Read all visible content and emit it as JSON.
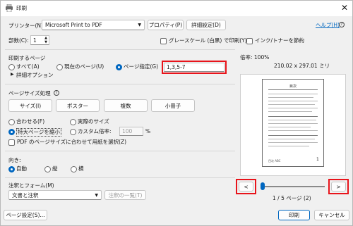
{
  "window": {
    "title": "印刷"
  },
  "printer": {
    "label": "プリンター(N):",
    "selected": "Microsoft Print to PDF",
    "properties_button": "プロパティ(P)",
    "advanced_button": "詳細設定(D)",
    "help_link": "ヘルプ(H)"
  },
  "copies": {
    "label": "部数(C):",
    "value": "1"
  },
  "options": {
    "grayscale": "グレースケール (白黒) で印刷(Y)",
    "ink_save": "インク/トナーを節約"
  },
  "pages_to_print": {
    "title": "印刷するページ",
    "all": "すべて(A)",
    "current": "現在のページ(U)",
    "specified": "ページ指定(G)",
    "range_value": "1,3,5-7",
    "more_options": "詳細オプション"
  },
  "page_sizing": {
    "title": "ページサイズ処理",
    "tabs": [
      "サイズ(I)",
      "ポスター",
      "複数",
      "小冊子"
    ],
    "fit": "合わせる(F)",
    "actual": "実際のサイズ",
    "shrink": "特大ページを縮小",
    "custom": "カスタム倍率:",
    "custom_value": "100",
    "percent": "%",
    "pdf_paper": "PDF のページサイズに合わせて用紙を選択(Z)"
  },
  "orientation": {
    "title": "向き:",
    "auto": "自動",
    "portrait": "縦",
    "landscape": "横"
  },
  "comments": {
    "title": "注釈とフォーム(M)",
    "selected": "文書と注釈",
    "summary_button": "注釈の一覧(T)"
  },
  "preview": {
    "scale": "倍率: 100%",
    "dimensions": "210.02 x 297.01 ミリ",
    "page_status": "1 / 5 ページ (2)",
    "page_heading": "目次",
    "page_footer_left": "目次 ABC",
    "page_number": "1",
    "prev_symbol": "<",
    "next_symbol": ">"
  },
  "footer": {
    "page_setup": "ページ設定(S)...",
    "print": "印刷",
    "cancel": "キャンセル"
  },
  "colors": {
    "accent": "#0067c0",
    "highlight": "#e8141b"
  }
}
